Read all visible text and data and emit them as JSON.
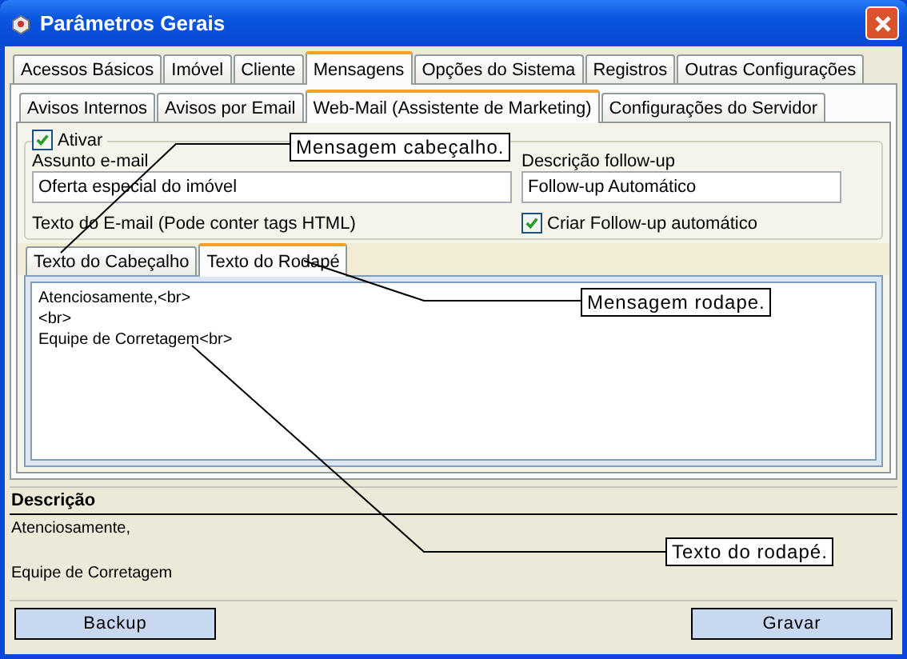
{
  "window": {
    "title": "Parâmetros Gerais"
  },
  "tabs": [
    {
      "label": "Acessos Básicos",
      "selected": false
    },
    {
      "label": "Imóvel",
      "selected": false
    },
    {
      "label": "Cliente",
      "selected": false
    },
    {
      "label": "Mensagens",
      "selected": true
    },
    {
      "label": "Opções do Sistema",
      "selected": false
    },
    {
      "label": "Registros",
      "selected": false
    },
    {
      "label": "Outras Configurações",
      "selected": false
    }
  ],
  "subtabs": [
    {
      "label": "Avisos Internos",
      "selected": false
    },
    {
      "label": "Avisos por Email",
      "selected": false
    },
    {
      "label": "Web-Mail (Assistente de Marketing)",
      "selected": true
    },
    {
      "label": "Configurações do Servidor",
      "selected": false
    }
  ],
  "group": {
    "label": "Ativar",
    "checked": true
  },
  "subject": {
    "label": "Assunto e-mail",
    "value": "Oferta especial do imóvel"
  },
  "followup": {
    "label": "Descrição follow-up",
    "value": "Follow-up Automático"
  },
  "email_text_label": "Texto do E-mail (Pode conter tags HTML)",
  "create_followup": {
    "label": "Criar Follow-up automático",
    "checked": true
  },
  "text_tabs": [
    {
      "label": "Texto do Cabeçalho",
      "selected": false
    },
    {
      "label": "Texto do Rodapé",
      "selected": true
    }
  ],
  "editor": {
    "value": "Atenciosamente,<br>\n<br>\nEquipe de Corretagem<br>"
  },
  "description": {
    "title": "Descrição",
    "lines": [
      "Atenciosamente,",
      "Equipe de Corretagem"
    ]
  },
  "buttons": [
    {
      "label": "Backup"
    },
    {
      "label": "Gravar"
    }
  ],
  "annotations": [
    {
      "text": "Mensagem cabeçalho."
    },
    {
      "text": "Mensagem rodape."
    },
    {
      "text": "Texto do rodapé."
    }
  ]
}
